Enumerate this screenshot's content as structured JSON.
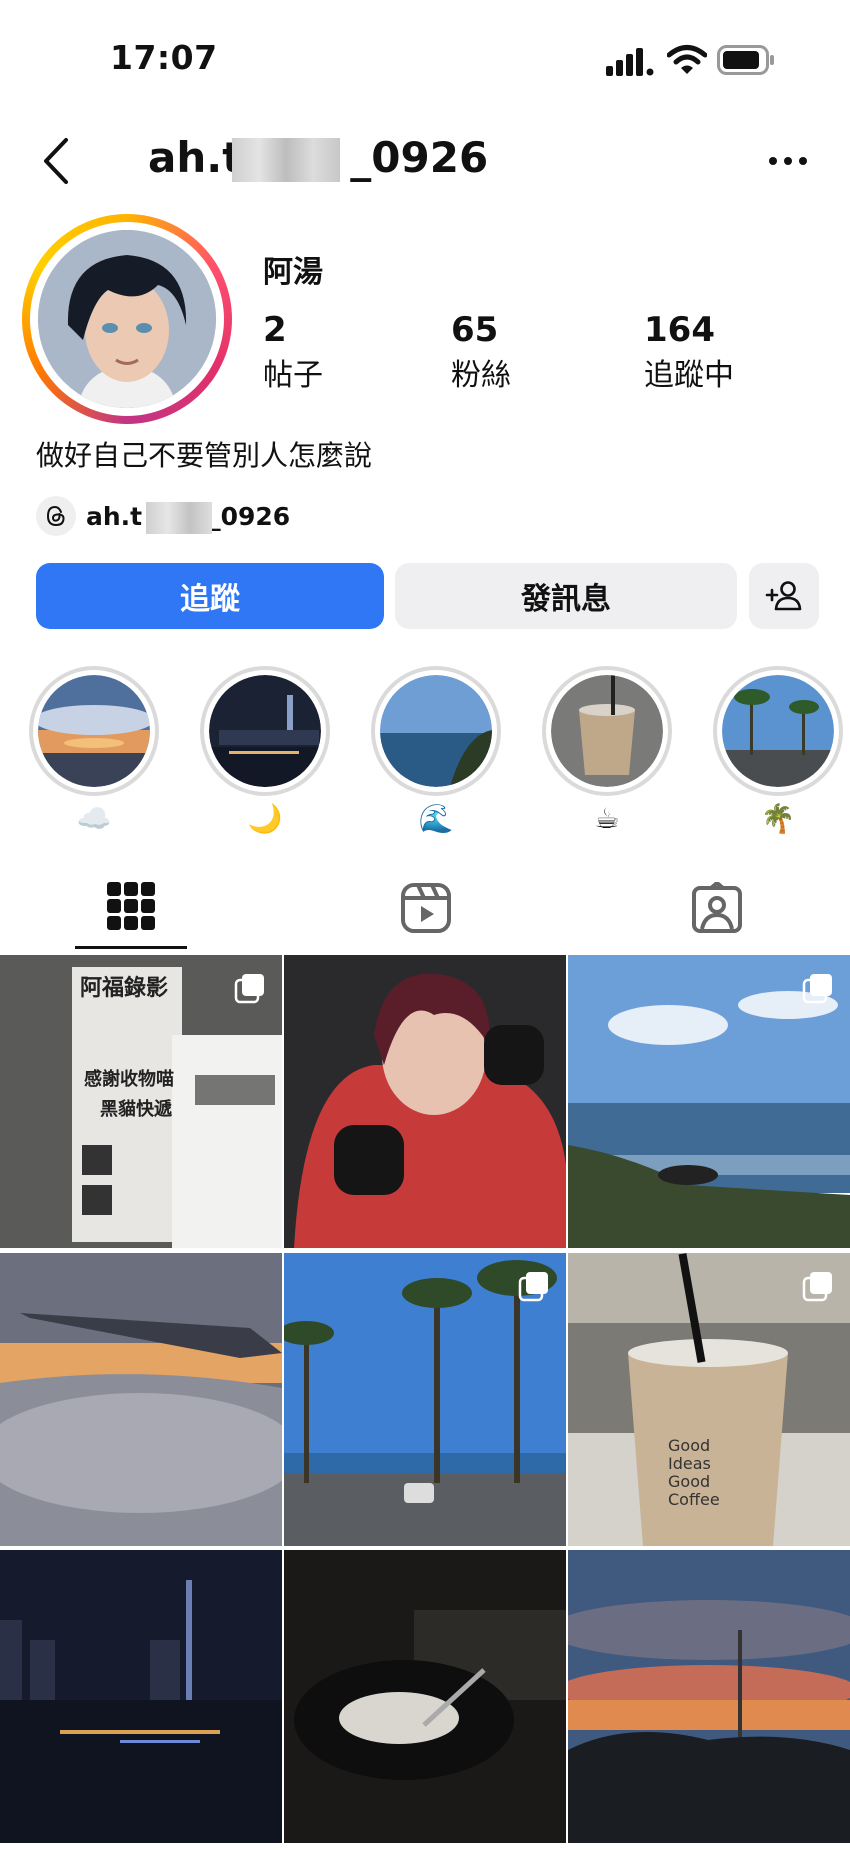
{
  "status": {
    "time": "17:07"
  },
  "header": {
    "handle_prefix": "ah.t",
    "handle_suffix": "_0926"
  },
  "profile": {
    "display_name": "阿湯",
    "stats": [
      {
        "value": "2",
        "label": "帖子"
      },
      {
        "value": "65",
        "label": "粉絲"
      },
      {
        "value": "164",
        "label": "追蹤中"
      }
    ],
    "bio": "做好自己不要管別人怎麼說",
    "threads_prefix": "ah.t",
    "threads_suffix": "_0926"
  },
  "actions": {
    "follow": "追蹤",
    "message": "發訊息"
  },
  "highlights": [
    {
      "emoji": "☁️"
    },
    {
      "emoji": "🌙"
    },
    {
      "emoji": "🌊"
    },
    {
      "emoji": "☕"
    },
    {
      "emoji": "🌴"
    }
  ],
  "tabs": [
    "posts-grid-icon",
    "reels-icon",
    "tagged-icon"
  ],
  "colors": {
    "primary_button": "#2f77f5",
    "secondary_button": "#efeff2"
  },
  "grid_texts": {
    "post1_line1": "阿福錄影",
    "post1_line2": "感謝收物喵",
    "post1_line3": "黑貓快遞",
    "cup_line1": "Good",
    "cup_line2": "Ideas",
    "cup_line3": "Good",
    "cup_line4": "Coffee"
  }
}
